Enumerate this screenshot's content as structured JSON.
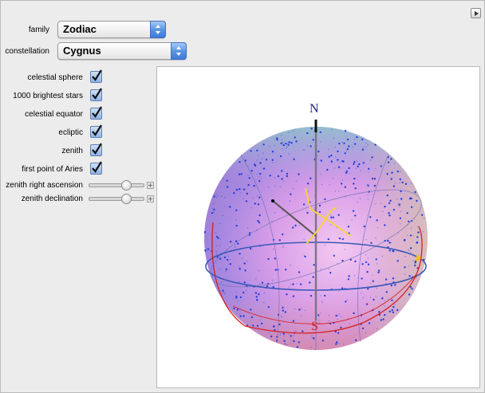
{
  "controls": {
    "family": {
      "label": "family",
      "value": "Zodiac"
    },
    "constellation": {
      "label": "constellation",
      "value": "Cygnus"
    },
    "checkboxes": [
      {
        "label": "celestial sphere",
        "checked": true
      },
      {
        "label": "1000 brightest stars",
        "checked": true
      },
      {
        "label": "celestial equator",
        "checked": true
      },
      {
        "label": "ecliptic",
        "checked": true
      },
      {
        "label": "zenith",
        "checked": true
      },
      {
        "label": "first point of Aries",
        "checked": true
      }
    ],
    "sliders": [
      {
        "label": "zenith right ascension",
        "value": 0.75
      },
      {
        "label": "zenith declination",
        "value": 0.75
      }
    ]
  },
  "sphere": {
    "north_label": "N",
    "south_label": "S",
    "colors": {
      "stars": "#1f3bd9",
      "equator": "#3a59b8",
      "ecliptic": "#d62020",
      "constellation": "#f5d535",
      "north": "#1a1a7a",
      "south": "#d42020"
    }
  }
}
